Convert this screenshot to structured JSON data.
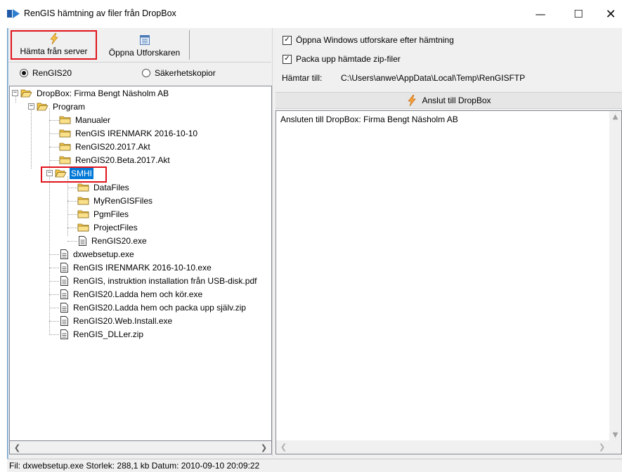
{
  "window": {
    "title": "RenGIS hämtning av filer från DropBox",
    "minimize_glyph": "—",
    "maximize_glyph": "☐",
    "close_glyph": "✕"
  },
  "toolbar": {
    "fetch_label": "Hämta från server",
    "fetch_icon": "lightning-icon",
    "open_label": "Öppna Utforskaren",
    "open_icon": "explorer-window-icon"
  },
  "source": {
    "options": [
      "RenGIS20",
      "Säkerhetskopior"
    ],
    "selected": "RenGIS20"
  },
  "tree": {
    "root": "DropBox: Firma Bengt Näsholm AB",
    "program": "Program",
    "program_children": [
      "Manualer",
      "RenGIS IRENMARK 2016-10-10",
      "RenGIS20.2017.Akt",
      "RenGIS20.Beta.2017.Akt"
    ],
    "smhi": "SMHI",
    "smhi_folders": [
      "DataFiles",
      "MyRenGISFiles",
      "PgmFiles",
      "ProjectFiles"
    ],
    "smhi_file": "RenGIS20.exe",
    "files": [
      "dxwebsetup.exe",
      "RenGIS IRENMARK 2016-10-10.exe",
      "RenGIS, instruktion installation från USB-disk.pdf",
      "RenGIS20.Ladda hem och kör.exe",
      "RenGIS20.Ladda hem och packa upp själv.zip",
      "RenGIS20.Web.Install.exe",
      "RenGIS_DLLer.zip"
    ],
    "selected": "SMHI"
  },
  "options": {
    "open_explorer_label": "Öppna Windows utforskare efter hämtning",
    "open_explorer_checked": true,
    "unpack_zip_label": "Packa upp hämtade zip-filer",
    "unpack_zip_checked": true,
    "destination_label": "Hämtar till:",
    "destination_path": "C:\\Users\\anwe\\AppData\\Local\\Temp\\RenGISFTP"
  },
  "connect": {
    "label": "Anslut till DropBox",
    "icon": "lightning-icon"
  },
  "log": {
    "text": "Ansluten till DropBox: Firma Bengt Näsholm AB"
  },
  "status": {
    "text": "Fil: dxwebsetup.exe Storlek: 288,1 kb Datum: 2010-09-10 20:09:22"
  },
  "colors": {
    "selection": "#0078d7",
    "highlight_box": "#e0141c",
    "folder": "#f5c542",
    "lightning": "#f0a020"
  }
}
